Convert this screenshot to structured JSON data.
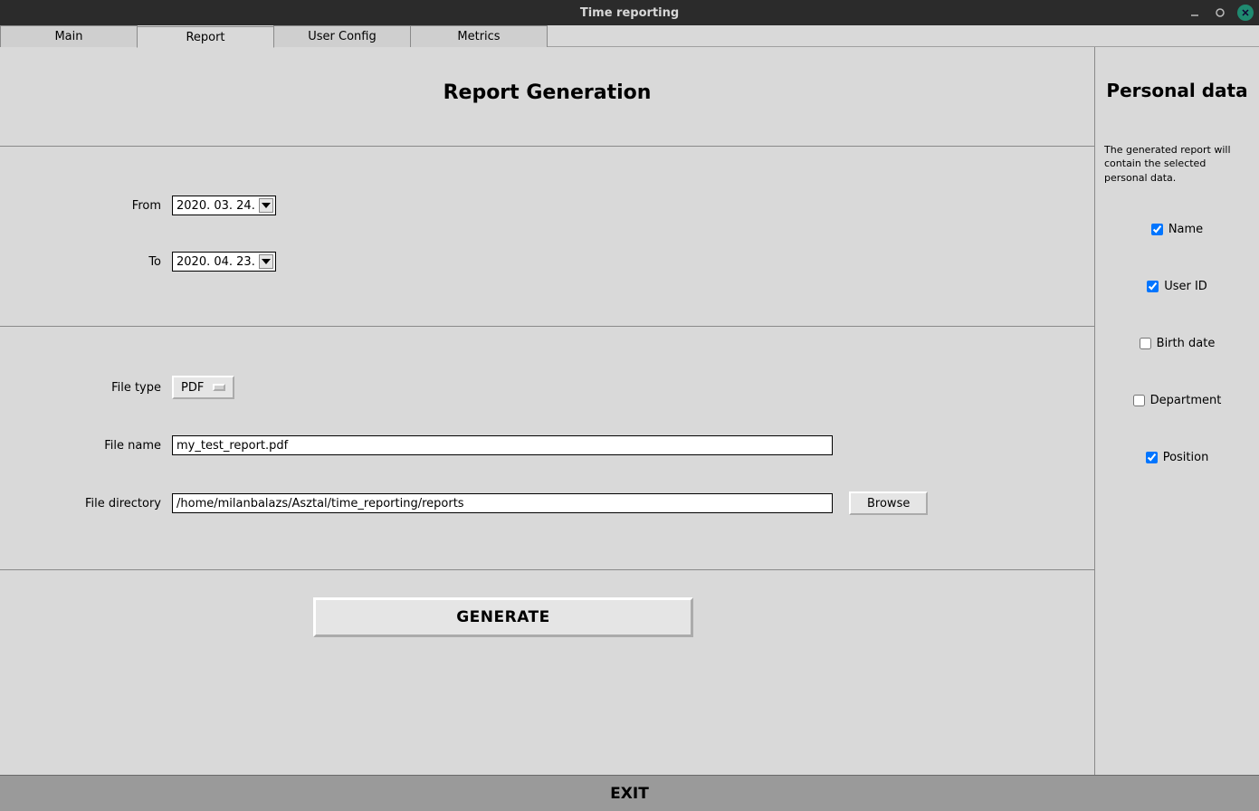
{
  "window": {
    "title": "Time reporting"
  },
  "tabs": {
    "main": "Main",
    "report": "Report",
    "user_config": "User Config",
    "metrics": "Metrics"
  },
  "main": {
    "heading": "Report Generation",
    "labels": {
      "from": "From",
      "to": "To",
      "file_type": "File type",
      "file_name": "File name",
      "file_directory": "File directory"
    },
    "values": {
      "from_date": "2020. 03. 24.",
      "to_date": "2020. 04. 23.",
      "file_type_selected": "PDF",
      "file_name": "my_test_report.pdf",
      "file_directory": "/home/milanbalazs/Asztal/time_reporting/reports"
    },
    "buttons": {
      "browse": "Browse",
      "generate": "GENERATE",
      "exit": "EXIT"
    }
  },
  "side": {
    "heading": "Personal data",
    "description": "The generated report will contain the selected personal data.",
    "options": {
      "name": {
        "label": "Name",
        "checked": true
      },
      "user_id": {
        "label": "User ID",
        "checked": true
      },
      "birth_date": {
        "label": "Birth date",
        "checked": false
      },
      "department": {
        "label": "Department",
        "checked": false
      },
      "position": {
        "label": "Position",
        "checked": true
      }
    }
  }
}
